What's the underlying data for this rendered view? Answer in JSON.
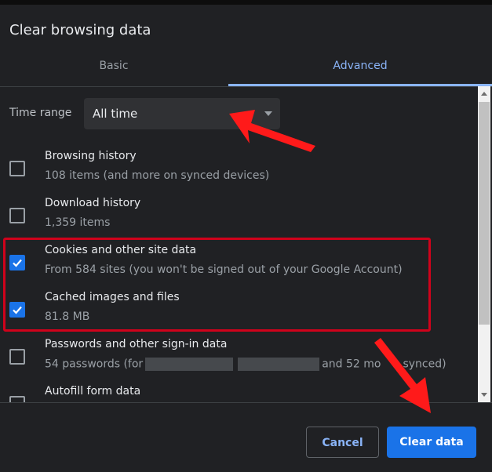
{
  "dialog": {
    "title": "Clear browsing data",
    "tabs": [
      {
        "label": "Basic",
        "active": false
      },
      {
        "label": "Advanced",
        "active": true
      }
    ]
  },
  "time_range": {
    "label": "Time range",
    "value": "All time"
  },
  "items": [
    {
      "title": "Browsing history",
      "desc": "108 items (and more on synced devices)",
      "checked": false
    },
    {
      "title": "Download history",
      "desc": "1,359 items",
      "checked": false
    },
    {
      "title": "Cookies and other site data",
      "desc": "From 584 sites (you won't be signed out of your Google Account)",
      "checked": true
    },
    {
      "title": "Cached images and files",
      "desc": "81.8 MB",
      "checked": true
    },
    {
      "title": "Passwords and other sign-in data",
      "desc_prefix": "54 passwords (for",
      "desc_suffix": "and 52 mo",
      "desc_end": "synced)",
      "checked": false
    },
    {
      "title": "Autofill form data",
      "checked": false
    }
  ],
  "footer": {
    "cancel_label": "Cancel",
    "clear_label": "Clear data"
  },
  "colors": {
    "accent": "#8ab4f8",
    "primary_button": "#1a73e8",
    "highlight": "#d0021b",
    "annotation_arrow": "#ff1a1a"
  }
}
